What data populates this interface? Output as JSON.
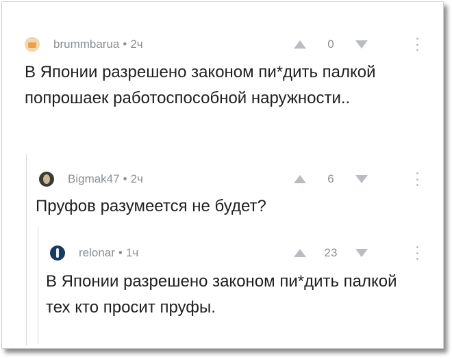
{
  "comments": [
    {
      "author": "brummbarua",
      "time": "2ч",
      "score": "0",
      "text": "В Японии разрешено законом пи*дить палкой попрошаек работоспособной наружности.."
    },
    {
      "author": "Bigmak47",
      "time": "2ч",
      "score": "6",
      "text": "Пруфов разумеется не будет?"
    },
    {
      "author": "relonar",
      "time": "1ч",
      "score": "23",
      "text": "В Японии разрешено законом пи*дить палкой тех кто просит пруфы."
    }
  ],
  "separator": "•",
  "colors": {
    "meta": "#8a8f94",
    "text": "#1f1f1f",
    "vote_arrow": "#b9bdc1",
    "thread_line": "#d6d9dc"
  },
  "icons": {
    "upvote": "triangle-up-icon",
    "downvote": "triangle-down-icon",
    "more": "vertical-dots-icon"
  }
}
